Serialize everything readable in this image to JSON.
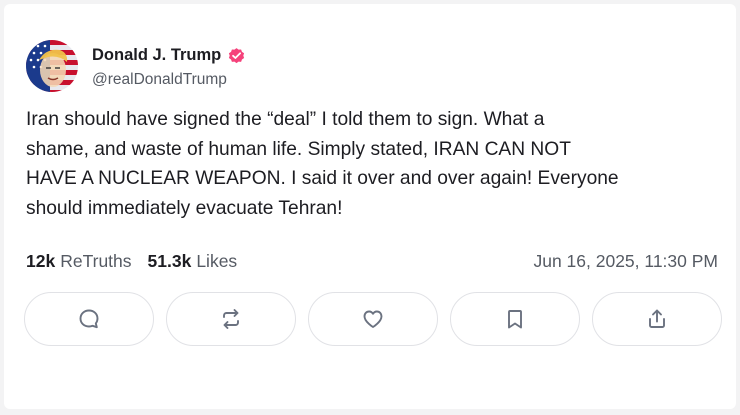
{
  "post": {
    "author": {
      "name": "Donald J. Trump",
      "handle": "@realDonaldTrump",
      "verified_badge_color": "#f5427b",
      "avatar_icon": "flag-portrait-avatar"
    },
    "text_lines": [
      "Iran should have signed the “deal” I told them to sign. What a",
      "shame, and waste of human life. Simply stated, IRAN CAN NOT",
      "HAVE A NUCLEAR WEAPON. I said it over and over again! Everyone",
      "should immediately evacuate Tehran!"
    ],
    "stats": {
      "retruths_count": "12k",
      "retruths_label": "ReTruths",
      "likes_count": "51.3k",
      "likes_label": "Likes"
    },
    "timestamp": "Jun 16, 2025, 11:30 PM",
    "actions": [
      {
        "name": "reply",
        "icon": "speech-bubble-icon"
      },
      {
        "name": "retruth",
        "icon": "repost-arrows-icon"
      },
      {
        "name": "like",
        "icon": "heart-icon"
      },
      {
        "name": "bookmark",
        "icon": "bookmark-icon"
      },
      {
        "name": "share",
        "icon": "share-upload-icon"
      }
    ]
  },
  "colors": {
    "text": "#1d1d22",
    "muted": "#555a63",
    "border": "#e1e2e6",
    "icon": "#6b7280"
  }
}
